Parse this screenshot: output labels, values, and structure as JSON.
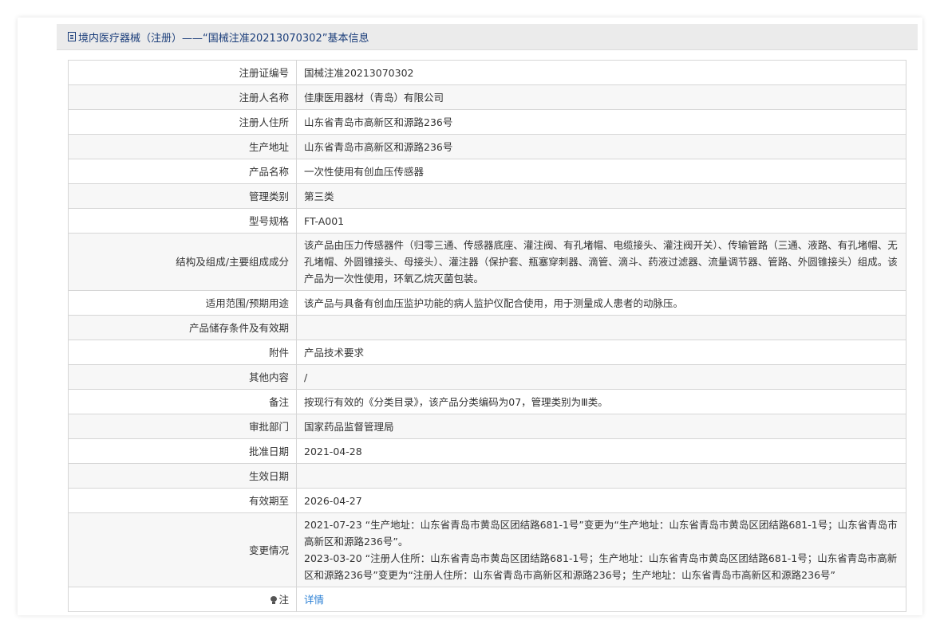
{
  "header": {
    "title": "境内医疗器械（注册）——“国械注准20213070302”基本信息",
    "icon": "document-icon"
  },
  "rows": [
    {
      "label": "注册证编号",
      "value": "国械注准20213070302"
    },
    {
      "label": "注册人名称",
      "value": "佳康医用器材（青岛）有限公司"
    },
    {
      "label": "注册人住所",
      "value": "山东省青岛市高新区和源路236号"
    },
    {
      "label": "生产地址",
      "value": "山东省青岛市高新区和源路236号"
    },
    {
      "label": "产品名称",
      "value": "一次性使用有创血压传感器"
    },
    {
      "label": "管理类别",
      "value": "第三类"
    },
    {
      "label": "型号规格",
      "value": "FT-A001"
    },
    {
      "label": "结构及组成/主要组成成分",
      "value": "该产品由压力传感器件（归零三通、传感器底座、灌注阀、有孔堵帽、电缆接头、灌注阀开关）、传输管路（三通、液路、有孔堵帽、无孔堵帽、外圆锥接头、母接头）、灌注器（保护套、瓶塞穿刺器、滴管、滴斗、药液过滤器、流量调节器、管路、外圆锥接头）组成。该产品为一次性使用，环氧乙烷灭菌包装。"
    },
    {
      "label": "适用范围/预期用途",
      "value": "该产品与具备有创血压监护功能的病人监护仪配合使用，用于测量成人患者的动脉压。"
    },
    {
      "label": "产品储存条件及有效期",
      "value": ""
    },
    {
      "label": "附件",
      "value": "产品技术要求"
    },
    {
      "label": "其他内容",
      "value": "/"
    },
    {
      "label": "备注",
      "value": "按现行有效的《分类目录》，该产品分类编码为07，管理类别为Ⅲ类。"
    },
    {
      "label": "审批部门",
      "value": "国家药品监督管理局"
    },
    {
      "label": "批准日期",
      "value": "2021-04-28"
    },
    {
      "label": "生效日期",
      "value": ""
    },
    {
      "label": "有效期至",
      "value": "2026-04-27"
    }
  ],
  "changes": {
    "label": "变更情况",
    "entries": [
      "2021-07-23 “生产地址：山东省青岛市黄岛区团结路681-1号”变更为“生产地址：山东省青岛市黄岛区团结路681-1号；山东省青岛市高新区和源路236号”。",
      "2023-03-20 “注册人住所：山东省青岛市黄岛区团结路681-1号；生产地址：山东省青岛市黄岛区团结路681-1号；山东省青岛市高新区和源路236号”变更为“注册人住所：山东省青岛市高新区和源路236号；生产地址：山东省青岛市高新区和源路236号”"
    ]
  },
  "note": {
    "label": "注",
    "icon": "lightbulb-icon",
    "link_text": "详情"
  },
  "colors": {
    "header_text": "#1a3d7a",
    "link": "#2a7fd4",
    "stripe": "#f7f7f7",
    "border": "#d6d6d6"
  }
}
